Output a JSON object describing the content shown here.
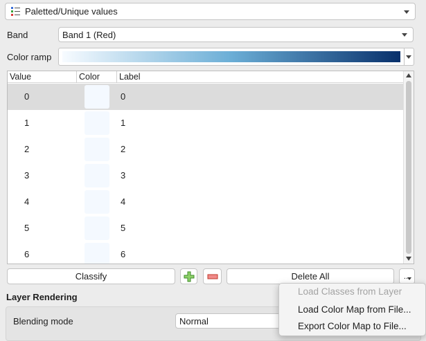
{
  "renderer": {
    "selected": "Paletted/Unique values",
    "icon": "paletted-renderer-icon"
  },
  "band": {
    "label": "Band",
    "selected": "Band 1 (Red)"
  },
  "color_ramp": {
    "label": "Color ramp",
    "from_color": "#f7fbff",
    "to_color": "#08306b"
  },
  "table": {
    "columns": [
      "Value",
      "Color",
      "Label"
    ],
    "rows": [
      {
        "value": "0",
        "color": "#f4f9ff",
        "label": "0",
        "selected": true
      },
      {
        "value": "1",
        "color": "#f4f9ff",
        "label": "1"
      },
      {
        "value": "2",
        "color": "#f4f9ff",
        "label": "2"
      },
      {
        "value": "3",
        "color": "#f4f9ff",
        "label": "3"
      },
      {
        "value": "4",
        "color": "#f4f9ff",
        "label": "4"
      },
      {
        "value": "5",
        "color": "#f4f9ff",
        "label": "5"
      },
      {
        "value": "6",
        "color": "#f4f9ff",
        "label": "6"
      }
    ]
  },
  "buttons": {
    "classify": "Classify",
    "delete_all": "Delete All",
    "more": "...",
    "add_icon": "plus-icon",
    "remove_icon": "minus-icon"
  },
  "layer_rendering": {
    "title": "Layer Rendering",
    "blending_mode_label": "Blending mode",
    "blending_mode_value": "Normal"
  },
  "menu": {
    "items": [
      {
        "label": "Load Classes from Layer",
        "enabled": false
      },
      {
        "label": "Load Color Map from File...",
        "enabled": true
      },
      {
        "label": "Export Color Map to File...",
        "enabled": true
      }
    ]
  }
}
